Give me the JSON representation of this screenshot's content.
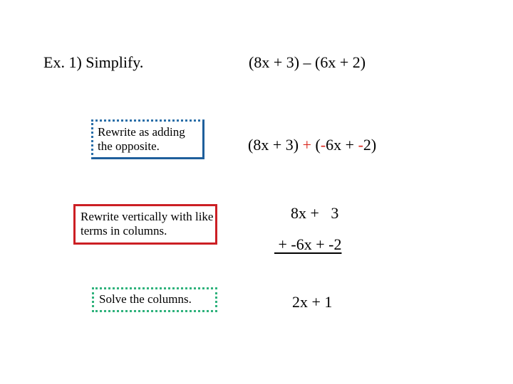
{
  "title": "Ex. 1) Simplify.",
  "original_expression": "(8x + 3) – (6x + 2)",
  "steps": [
    {
      "instruction": "Rewrite as adding the opposite.",
      "box_color": "#2a6ea8",
      "expression_parts": [
        {
          "text": "(8x + 3) ",
          "color": "#000000"
        },
        {
          "text": "+",
          "color": "#d9261c"
        },
        {
          "text": " (",
          "color": "#000000"
        },
        {
          "text": "-",
          "color": "#d9261c"
        },
        {
          "text": "6x + ",
          "color": "#000000"
        },
        {
          "text": "-",
          "color": "#d9261c"
        },
        {
          "text": "2)",
          "color": "#000000"
        }
      ]
    },
    {
      "instruction": "Rewrite vertically with like terms in columns.",
      "box_color": "#cc1f24",
      "line1": "8x +   3",
      "line2": " + -6x + -2"
    },
    {
      "instruction": "Solve the columns.",
      "box_color": "#2fb27c",
      "result": "2x + 1"
    }
  ]
}
